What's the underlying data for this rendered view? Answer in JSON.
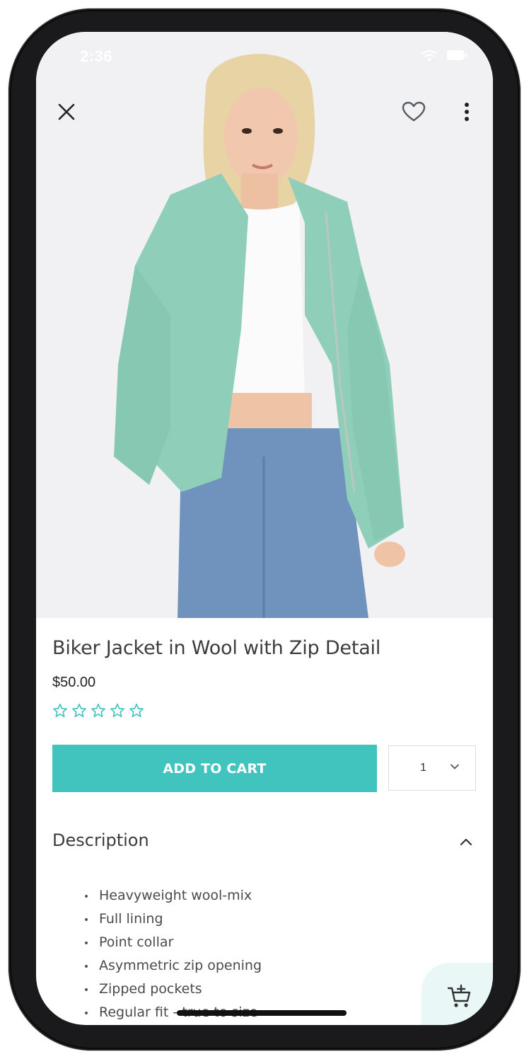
{
  "status_bar": {
    "time": "2:36"
  },
  "topbar": {
    "close_icon": "close-icon",
    "favorite_icon": "heart-icon",
    "more_icon": "more-vert-icon"
  },
  "product": {
    "title": "Biker Jacket in Wool with Zip Detail",
    "price": "$50.00",
    "rating": {
      "value": 0,
      "max": 5
    },
    "add_to_cart_label": "ADD TO CART",
    "quantity": "1"
  },
  "description": {
    "heading": "Description",
    "expanded": true,
    "items": [
      "Heavyweight wool-mix",
      "Full lining",
      "Point collar",
      "Asymmetric zip opening",
      "Zipped pockets",
      "Regular fit - true to size"
    ]
  },
  "colors": {
    "accent": "#41c4bd",
    "fab_bg": "#e9f7f6",
    "jacket": "#8fcfba",
    "jeans": "#6f93bd"
  }
}
